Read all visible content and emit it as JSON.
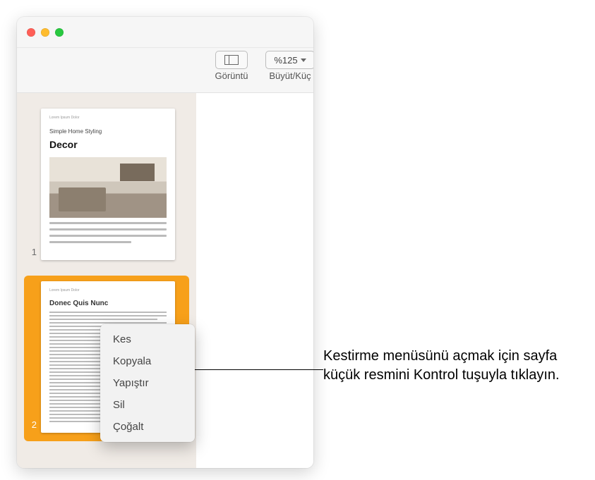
{
  "toolbar": {
    "view_label": "Görüntü",
    "zoom_label": "Büyüt/Küç",
    "zoom_value": "%125"
  },
  "sidebar": {
    "pages": [
      {
        "number": "1",
        "header": "Lorem Ipsum Dolor",
        "subtitle": "Simple Home Styling",
        "title": "Decor"
      },
      {
        "number": "2",
        "header": "Lorem Ipsum Dolor",
        "title": "Donec Quis Nunc"
      }
    ]
  },
  "context_menu": {
    "items": [
      {
        "label": "Kes"
      },
      {
        "label": "Kopyala"
      },
      {
        "label": "Yapıştır"
      },
      {
        "label": "Sil"
      },
      {
        "label": "Çoğalt"
      }
    ]
  },
  "callout": {
    "text": "Kestirme menüsünü açmak için sayfa küçük resmini Kontrol tuşuyla tıklayın."
  }
}
